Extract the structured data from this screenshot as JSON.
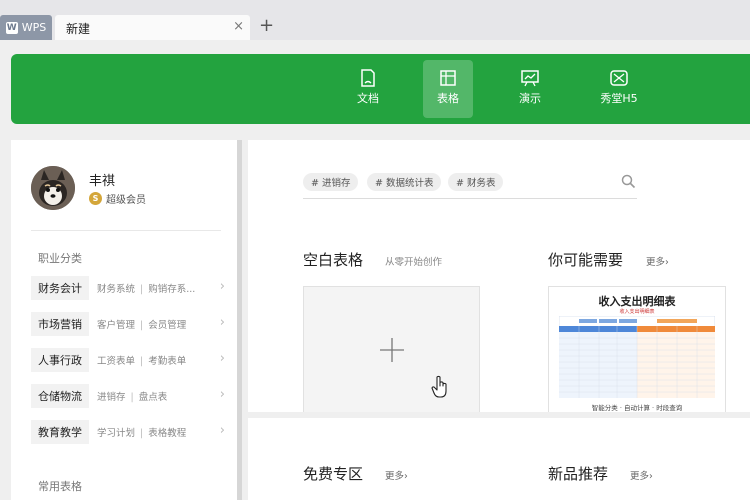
{
  "tabs": {
    "app_label": "WPS",
    "app_logo_letter": "W",
    "current_tab": "新建",
    "close_icon": "×",
    "add_tab": "+"
  },
  "nav": {
    "items": [
      {
        "label": "文档",
        "icon": "document-icon"
      },
      {
        "label": "表格",
        "icon": "spreadsheet-icon"
      },
      {
        "label": "演示",
        "icon": "presentation-icon"
      },
      {
        "label": "秀堂H5",
        "icon": "h5-icon"
      }
    ],
    "active": "表格",
    "accent_color": "#23a33f"
  },
  "user": {
    "name": "丰祺",
    "vip_label": "超级会员",
    "vip_badge": "S"
  },
  "sidebar": {
    "section_title": "职业分类",
    "categories": [
      {
        "name": "财务会计",
        "subs": [
          "财务系统",
          "购销存系..."
        ]
      },
      {
        "name": "市场营销",
        "subs": [
          "客户管理",
          "会员管理"
        ]
      },
      {
        "name": "人事行政",
        "subs": [
          "工资表单",
          "考勤表单"
        ]
      },
      {
        "name": "仓储物流",
        "subs": [
          "进销存",
          "盘点表"
        ]
      },
      {
        "name": "教育教学",
        "subs": [
          "学习计划",
          "表格教程"
        ]
      }
    ],
    "section2_title": "常用表格",
    "separator": "|",
    "arrow": "›"
  },
  "search": {
    "tags": [
      "# 进销存",
      "# 数据统计表",
      "# 财务表"
    ]
  },
  "blank": {
    "title": "空白表格",
    "subtitle": "从零开始创作"
  },
  "recommend": {
    "title": "你可能需要",
    "more": "更多",
    "more_arrow": "›",
    "template_title": "收入支出明细表",
    "template_subtitle": "收入支出明细表",
    "template_footer": "智能分类 · 自动计算 · 时段查询"
  },
  "lower": {
    "free_title": "免费专区",
    "free_more": "更多",
    "new_title": "新品推荐",
    "new_more": "更多",
    "more_arrow": "›"
  }
}
